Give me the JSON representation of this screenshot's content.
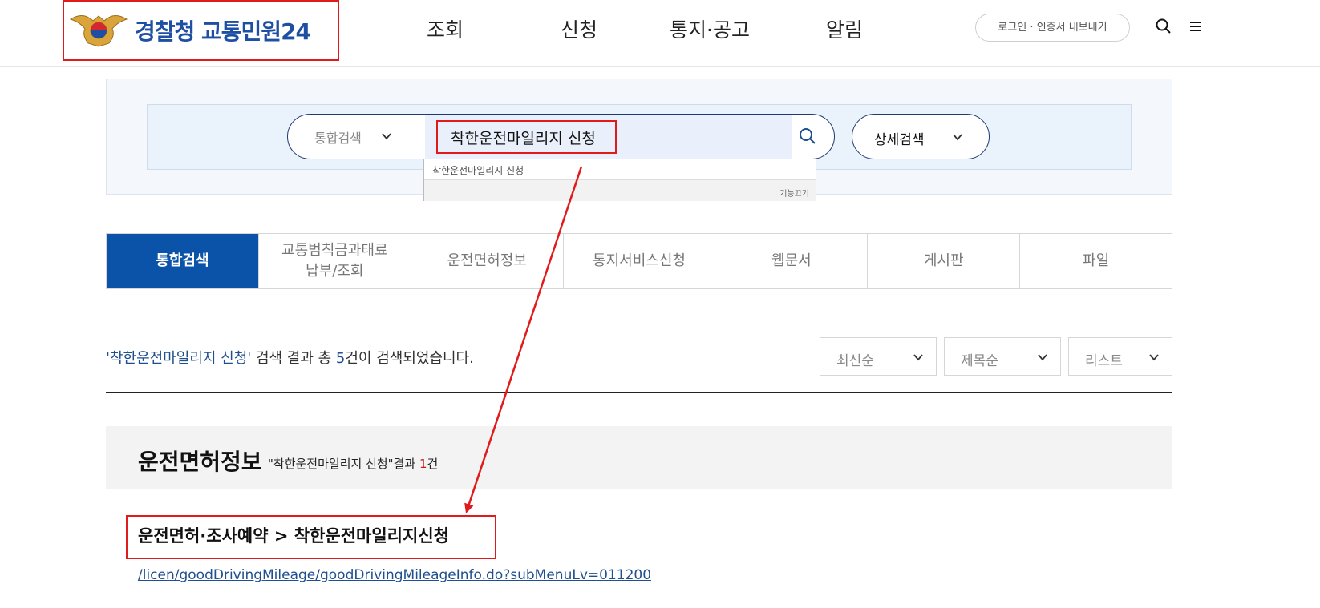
{
  "header": {
    "logo_text": "경찰청 교통민원24",
    "nav": [
      "조회",
      "신청",
      "통지·공고",
      "알림"
    ],
    "login_label": "로그인 · 인증서 내보내기"
  },
  "search": {
    "scope_label": "통합검색",
    "query": "착한운전마일리지 신청",
    "detail_label": "상세검색",
    "autocomplete": {
      "items": [
        "착한운전마일리지 신청"
      ],
      "off_label": "기능끄기"
    }
  },
  "tabs": [
    "통합검색",
    "교통범칙금과태료\n납부/조회",
    "운전면허정보",
    "통지서비스신청",
    "웹문서",
    "게시판",
    "파일"
  ],
  "summary": {
    "query_quoted": "'착한운전마일리지 신청'",
    "text_before": " 검색 결과 총 ",
    "count": "5",
    "text_after": "건이 검색되었습니다."
  },
  "sort": [
    "최신순",
    "제목순",
    "리스트"
  ],
  "category": {
    "title": "운전면허정보",
    "count_prefix": "\"착한운전마일리지 신청\"결과 ",
    "count": "1",
    "count_suffix": "건"
  },
  "result": {
    "title": "운전면허·조사예약 > 착한운전마일리지신청",
    "url": "/licen/goodDrivingMileage/goodDrivingMileageInfo.do?subMenuLv=011200"
  },
  "colors": {
    "accent": "#0a53a8",
    "highlight": "#e01b1b",
    "link": "#1f4f8e"
  }
}
